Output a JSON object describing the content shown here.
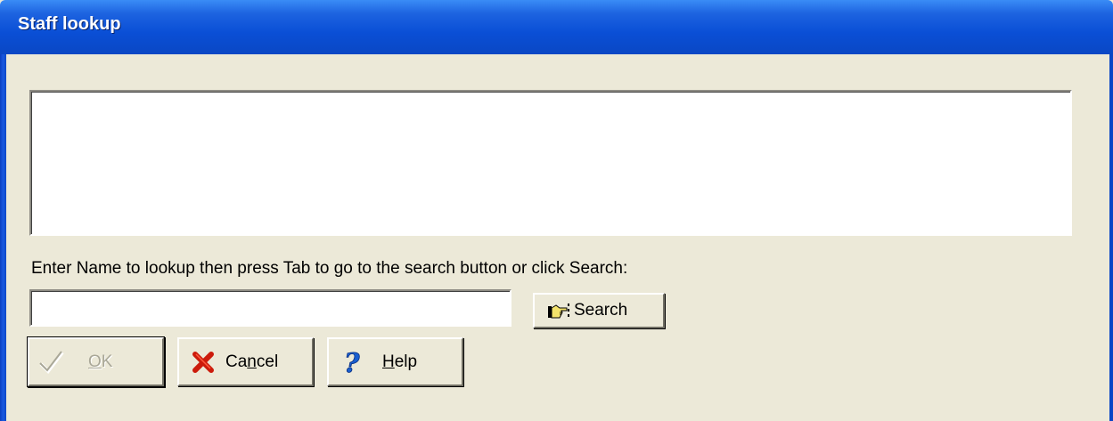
{
  "window": {
    "title": "Staff lookup"
  },
  "form": {
    "prompt": "Enter Name to lookup then press Tab to go to the search button or click Search:",
    "name_value": "",
    "results": []
  },
  "buttons": {
    "search": {
      "label": "Search",
      "icon": "pointing-hand-icon"
    },
    "ok": {
      "pre": "",
      "accel": "O",
      "post": "K",
      "icon": "checkmark-icon",
      "enabled": false
    },
    "cancel": {
      "pre": "Ca",
      "accel": "n",
      "post": "cel",
      "icon": "red-x-icon"
    },
    "help": {
      "pre": "",
      "accel": "H",
      "post": "elp",
      "icon": "question-mark-icon"
    }
  },
  "colors": {
    "title_bar": "#0a4fd6",
    "dialog_bg": "#ece9d8",
    "cancel_icon": "#cc1b0b",
    "help_icon": "#1a5fd0"
  }
}
